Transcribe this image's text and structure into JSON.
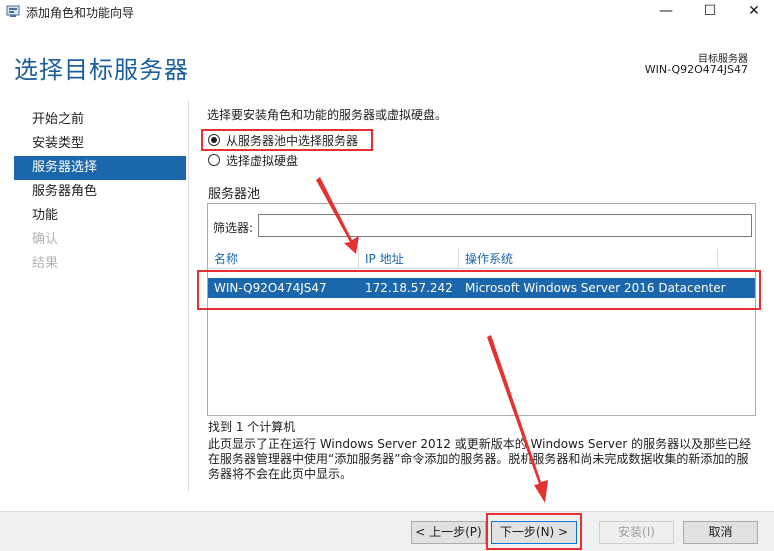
{
  "window": {
    "title": "添加角色和功能向导",
    "controls": [
      "minimize",
      "maximize",
      "close"
    ]
  },
  "header": {
    "title": "选择目标服务器",
    "target_label": "目标服务器",
    "target_name": "WIN-Q92O474JS47"
  },
  "nav": {
    "items": [
      {
        "label": "开始之前",
        "state": "normal"
      },
      {
        "label": "安装类型",
        "state": "normal"
      },
      {
        "label": "服务器选择",
        "state": "active"
      },
      {
        "label": "服务器角色",
        "state": "normal"
      },
      {
        "label": "功能",
        "state": "normal"
      },
      {
        "label": "确认",
        "state": "disabled"
      },
      {
        "label": "结果",
        "state": "disabled"
      }
    ]
  },
  "main": {
    "instruction": "选择要安装角色和功能的服务器或虚拟硬盘。",
    "options": [
      {
        "label": "从服务器池中选择服务器",
        "checked": true
      },
      {
        "label": "选择虚拟硬盘",
        "checked": false
      }
    ],
    "pool_title": "服务器池",
    "filter_label": "筛选器:",
    "filter_value": "",
    "columns": [
      "名称",
      "IP 地址",
      "操作系统"
    ],
    "rows": [
      {
        "name": "WIN-Q92O474JS47",
        "ip": "172.18.57.242",
        "os": "Microsoft Windows Server 2016 Datacenter",
        "selected": true
      }
    ],
    "found": "找到 1 个计算机",
    "note": "此页显示了正在运行 Windows Server 2012 或更新版本的 Windows Server 的服务器以及那些已经在服务器管理器中使用“添加服务器”命令添加的服务器。脱机服务器和尚未完成数据收集的新添加的服务器将不会在此页中显示。"
  },
  "footer": {
    "prev": "< 上一步(P)",
    "next": "下一步(N) >",
    "install": "安装(I)",
    "cancel": "取消"
  },
  "colors": {
    "accent": "#1b67ae",
    "title": "#1b5f9e",
    "highlight": "#e5312f"
  }
}
